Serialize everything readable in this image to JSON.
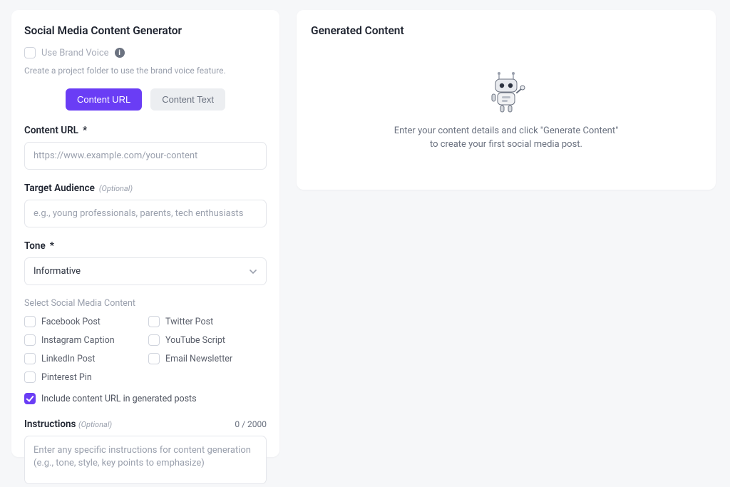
{
  "left": {
    "title": "Social Media Content Generator",
    "brand_voice_label": "Use Brand Voice",
    "brand_voice_hint": "Create a project folder to use the brand voice feature.",
    "tabs": {
      "content_url": "Content URL",
      "content_text": "Content Text"
    },
    "content_url": {
      "label": "Content URL",
      "required_mark": "*",
      "placeholder": "https://www.example.com/your-content",
      "value": ""
    },
    "audience": {
      "label": "Target Audience",
      "optional": "(Optional)",
      "placeholder": "e.g., young professionals, parents, tech enthusiasts",
      "value": ""
    },
    "tone": {
      "label": "Tone",
      "required_mark": "*",
      "value": "Informative"
    },
    "platforms": {
      "section_label": "Select Social Media Content",
      "opts": [
        "Facebook Post",
        "Twitter Post",
        "Instagram Caption",
        "YouTube Script",
        "LinkedIn Post",
        "Email Newsletter",
        "Pinterest Pin"
      ]
    },
    "include_url_label": "Include content URL in generated posts",
    "instructions": {
      "label": "Instructions",
      "optional": "(Optional)",
      "counter": "0 / 2000",
      "placeholder": "Enter any specific instructions for content generation (e.g., tone, style, key points to emphasize)",
      "value": ""
    }
  },
  "right": {
    "title": "Generated Content",
    "empty_line1": "Enter your content details and click \"Generate Content\"",
    "empty_line2": "to create your first social media post."
  }
}
